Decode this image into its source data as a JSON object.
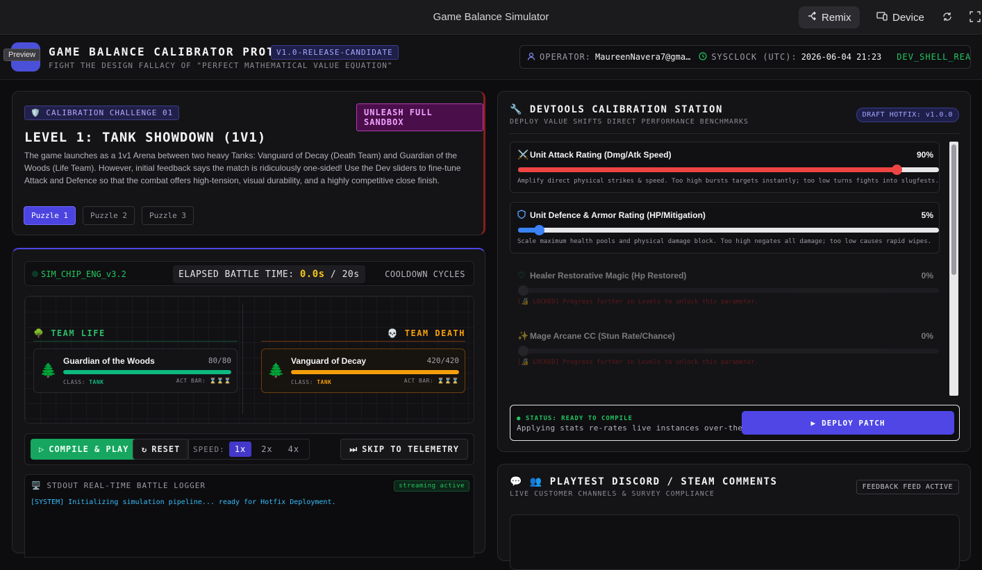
{
  "topbar": {
    "title": "Game Balance Simulator",
    "remix_label": "Remix",
    "device_label": "Device",
    "preview_tag": "Preview"
  },
  "header": {
    "title": "GAME BALANCE CALIBRATOR PROTO™",
    "version": "V1.0-RELEASE-CANDIDATE",
    "subtitle": "FIGHT THE DESIGN FALLACY OF \"PERFECT MATHEMATICAL VALUE EQUATION\"",
    "operator_label": "OPERATOR:",
    "operator_value": "MaureenNavera7@gma…",
    "sysclock_label": "SYSCLOCK (UTC):",
    "sysclock_value": "2026-06-04 21:23",
    "shell_status": "DEV_SHELL_READY"
  },
  "challenge": {
    "chip": "CALIBRATION CHALLENGE 01",
    "sandbox_button": "UNLEASH FULL SANDBOX",
    "title": "LEVEL 1: TANK SHOWDOWN (1V1)",
    "description": "The game launches as a 1v1 Arena between two heavy Tanks: Vanguard of Decay (Death Team) and Guardian of the Woods (Life Team). However, initial feedback says the match is ridiculously one-sided! Use the Dev sliders to fine-tune Attack and Defence so that the combat offers high-tension, visual durability, and a highly competitive close finish.",
    "puzzles": [
      "Puzzle 1",
      "Puzzle 2",
      "Puzzle 3"
    ],
    "active_puzzle": "Puzzle 1"
  },
  "simulator": {
    "engine": "SIM_CHIP_ENG_v3.2",
    "elapsed_label": "ELAPSED BATTLE TIME:",
    "elapsed_value": "0.0s",
    "elapsed_total": "/ 20s",
    "cooldown_label": "COOLDOWN CYCLES",
    "team_life": "TEAM LIFE",
    "team_death": "TEAM DEATH",
    "units": [
      {
        "name": "Guardian of the Woods",
        "hp": "80/80",
        "hp_fraction": 1.0,
        "class_label": "CLASS:",
        "class_value": "TANK",
        "act_label": "ACT BAR:",
        "act_value": "⌛⌛⌛",
        "color": "#10b981"
      },
      {
        "name": "Vanguard of Decay",
        "hp": "420/420",
        "hp_fraction": 1.0,
        "class_label": "CLASS:",
        "class_value": "TANK",
        "act_label": "ACT BAR:",
        "act_value": "⌛⌛⌛",
        "color": "#f59e0b"
      }
    ],
    "controls": {
      "play": "COMPILE & PLAY",
      "reset": "RESET",
      "speed_label": "SPEED:",
      "speeds": [
        "1x",
        "2x",
        "4x"
      ],
      "active_speed": "1x",
      "skip": "SKIP TO TELEMETRY"
    },
    "logger": {
      "title": "STDOUT REAL-TIME BATTLE LOGGER",
      "badge": "streaming active",
      "lines": [
        "[SYSTEM] Initializing simulation pipeline... ready for Hotfix Deployment."
      ]
    }
  },
  "devtools": {
    "title": "DEVTOOLS CALIBRATION STATION",
    "subtitle": "DEPLOY VALUE SHIFTS DIRECT PERFORMANCE BENCHMARKS",
    "badge": "DRAFT HOTFIX: v1.0.0",
    "params": [
      {
        "name": "Unit Attack Rating (Dmg/Atk Speed)",
        "value": "90%",
        "level": 0.9,
        "desc": "Amplify direct physical strikes & speed. Too high bursts targets instantly; too low turns fights into slugfests.",
        "color": "#ef4444",
        "icon": "crossed-swords-icon",
        "locked": false
      },
      {
        "name": "Unit Defence & Armor Rating (HP/Mitigation)",
        "value": "5%",
        "level": 0.05,
        "desc": "Scale maximum health pools and physical damage block. Too high negates all damage; too low causes rapid wipes.",
        "color": "#3b82f6",
        "icon": "shield-icon",
        "locked": false
      },
      {
        "name": "Healer Restorative Magic (Hp Restored)",
        "value": "0%",
        "level": 0.0,
        "desc": "[🔏 LOCKED] Progress further in Levels to unlock this parameter.",
        "color": "#22c55e",
        "icon": "heart-icon",
        "locked": true
      },
      {
        "name": "Mage Arcane CC (Stun Rate/Chance)",
        "value": "0%",
        "level": 0.0,
        "desc": "[🔏 LOCKED] Progress further in Levels to unlock this parameter.",
        "color": "#8b5cf6",
        "icon": "sparkle-icon",
        "locked": true
      }
    ],
    "compile_status": "● STATUS: READY TO COMPILE",
    "compile_desc": "Applying stats re-rates live instances over-the-air.",
    "deploy_button": "DEPLOY PATCH"
  },
  "discord": {
    "title": "PLAYTEST DISCORD / STEAM COMMENTS",
    "subtitle": "LIVE CUSTOMER CHANNELS & SURVEY COMPLIANCE",
    "badge": "FEEDBACK FEED ACTIVE"
  }
}
